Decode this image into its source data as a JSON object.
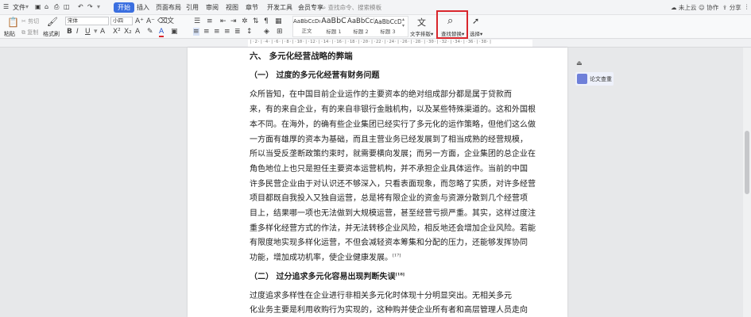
{
  "menu": {
    "file": "文件",
    "tabs": [
      "开始",
      "插入",
      "页面布局",
      "引用",
      "审阅",
      "视图",
      "章节",
      "开发工具",
      "会员专享"
    ],
    "search_placeholder": "查找命令、搜索模板",
    "cloud": "未上云",
    "collab": "协作",
    "share": "分享"
  },
  "ribbon": {
    "paste": "粘贴",
    "cut": "剪切",
    "copy": "复制",
    "format_painter": "格式刷",
    "font_name": "宋体",
    "font_size": "小四",
    "styles": [
      {
        "sample": "AaBbCcDd",
        "name": "正文"
      },
      {
        "sample": "AaBbC",
        "name": "标题 1"
      },
      {
        "sample": "AaBbCcI",
        "name": "标题 2"
      },
      {
        "sample": "AaBbCcD",
        "name": "标题 3"
      }
    ],
    "text_layout": "文字排版",
    "find_replace": "查找替换",
    "select": "选择"
  },
  "side_panel": {
    "paper_check": "论文查重"
  },
  "document": {
    "heading_main": "六、         多元化经营战略的弊端",
    "sub1": "（一）   过度的多元化经营有财务问题",
    "lines1": [
      "        众所皆知，在中国目前企业运作的主要资本的绝对组成部分都是属于贷款而",
      "来，有的来自企业，有的来自非银行金融机构，以及某些特殊渠道的。这和外国根",
      "本不同。在海外，的确有些企业集团已经实行了多元化的运作策略，但他们这么做",
      "一方面有雄厚的资本为基础，而且主营业务已经发展到了相当成熟的经营规模，",
      "所以当受反垄断政策约束时，就需要横向发展；而另一方面，企业集团的总企业在",
      "角色地位上也只是担任主要资本运营机构，并不承担企业具体运作。当前的中国",
      "许多民营企业由于对认识还不够深入，只看表面现象，而忽略了实质，对许多经营",
      "项目都既自我投入又独自运营，总是将有限企业的资金与资源分散到几个经营项",
      "目上，结果哪一项也无法做到大规模运营，甚至经营亏损严重。其实，这样过度注",
      "重多样化经营方式的作法，并无法转移企业风险，相反地还会增加企业风险。若能",
      "有限度地实现多样化运营，不但会减轻资本筹集和分配的压力，还能够发挥协同"
    ],
    "last_line1": "功能，增加成功机率，使企业健康发展。",
    "cite1": "[17]",
    "sub2": "（二）    过分追求多元化容易出现判断失误",
    "cite2": "[18]",
    "lines2": [
      "        过度追求多样性在企业进行非相关多元化时体现十分明显突出。无相关多元",
      "化业务主要是利用收购行为实现的，这种购并使企业所有者和高层管理人员走向"
    ]
  }
}
